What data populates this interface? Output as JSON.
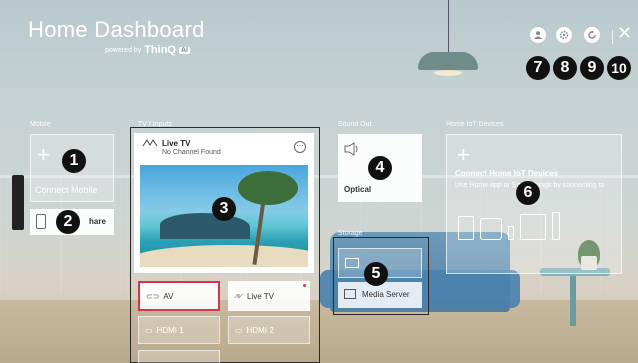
{
  "header": {
    "title": "Home Dashboard",
    "powered_by": "powered by",
    "brand": "ThinQ",
    "brand_badge": "AI",
    "close_icon": "✕"
  },
  "sections": {
    "mobile": "Mobile",
    "tv_inputs": "TV / Inputs",
    "sound_out": "Sound Out",
    "home_iot": "Home IoT Devices",
    "storage": "Storage"
  },
  "mobile": {
    "connect_label": "Connect Mobile",
    "share_label": "hare"
  },
  "live_tv": {
    "title": "Live TV",
    "subtitle": "No Channel Found",
    "more": "⋯"
  },
  "inputs": [
    {
      "label": "AV",
      "icon": "av-icon"
    },
    {
      "label": "Live TV",
      "icon": "antenna-icon"
    },
    {
      "label": "HDMI 1",
      "icon": "hdmi-icon"
    },
    {
      "label": "HDMI 2",
      "icon": "hdmi-icon"
    }
  ],
  "sound_out": {
    "label": "Optical",
    "icon": "speaker-icon"
  },
  "storage": {
    "server_label": "Media Server"
  },
  "iot": {
    "title": "Connect Home IoT Devices",
    "desc": "Use Home app or SmartThings by connecting to"
  },
  "callouts": [
    "1",
    "2",
    "3",
    "4",
    "5",
    "6",
    "7",
    "8",
    "9",
    "10"
  ],
  "colors": {
    "accent": "#d6344a",
    "callout_bg": "#111111"
  }
}
